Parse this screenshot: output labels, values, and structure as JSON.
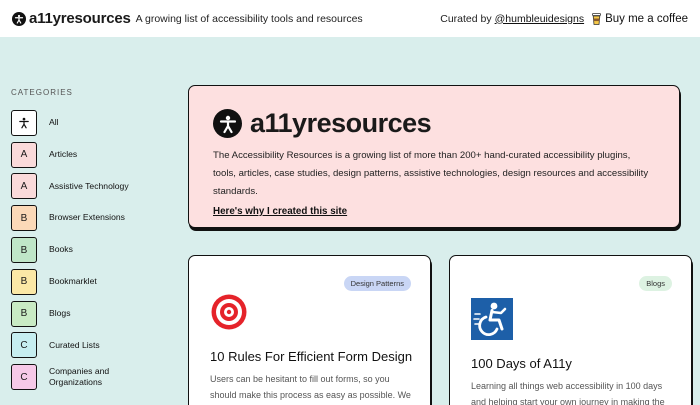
{
  "header": {
    "brand": "a11yresources",
    "tagline": "A growing list of accessibility tools and resources",
    "curated_by": "Curated by",
    "curator": "@humbleuidesigns",
    "coffee": "Buy me a coffee"
  },
  "sidebar": {
    "title": "CATEGORIES",
    "items": [
      {
        "badge": "",
        "label": "All",
        "color": "#ffffff"
      },
      {
        "badge": "A",
        "label": "Articles",
        "color": "#fadada"
      },
      {
        "badge": "A",
        "label": "Assistive Technology",
        "color": "#fadada"
      },
      {
        "badge": "B",
        "label": "Browser Extensions",
        "color": "#fbd9b8"
      },
      {
        "badge": "B",
        "label": "Books",
        "color": "#bfe6c8"
      },
      {
        "badge": "B",
        "label": "Bookmarklet",
        "color": "#fbe8a6"
      },
      {
        "badge": "B",
        "label": "Blogs",
        "color": "#c9ebc4"
      },
      {
        "badge": "C",
        "label": "Curated Lists",
        "color": "#c6eef0"
      },
      {
        "badge": "C",
        "label": "Companies and Organizations",
        "color": "#f6c9e8"
      }
    ]
  },
  "hero": {
    "title": "a11yresources",
    "description": "The Accessibility Resources is a growing list of more than 200+ hand-curated accessibility plugins, tools, articles, case studies, design patterns, assistive technologies, design resources and accessibility standards.",
    "link": "Here's why I created this site"
  },
  "cards": [
    {
      "tag": "Design Patterns",
      "title": "10 Rules For Efficient Form Design",
      "description": "Users can be hesitant to fill out forms, so you should make this process as easy as possible. We"
    },
    {
      "tag": "Blogs",
      "title": "100 Days of A11y",
      "description": "Learning all things web accessibility in 100 days and helping start your own journey in making the"
    }
  ],
  "colors": {
    "background": "#d9eeec",
    "hero": "#fde0e0",
    "tag_blue": "#c9d6f5",
    "tag_green": "#ddf2e2",
    "target_red": "#e5232a",
    "a11y_blue": "#1d5fa8"
  },
  "icons": {
    "brand": "accessibility-person-icon",
    "coffee": "coffee-cup-icon",
    "card1": "target-icon",
    "card2": "wheelchair-icon"
  }
}
